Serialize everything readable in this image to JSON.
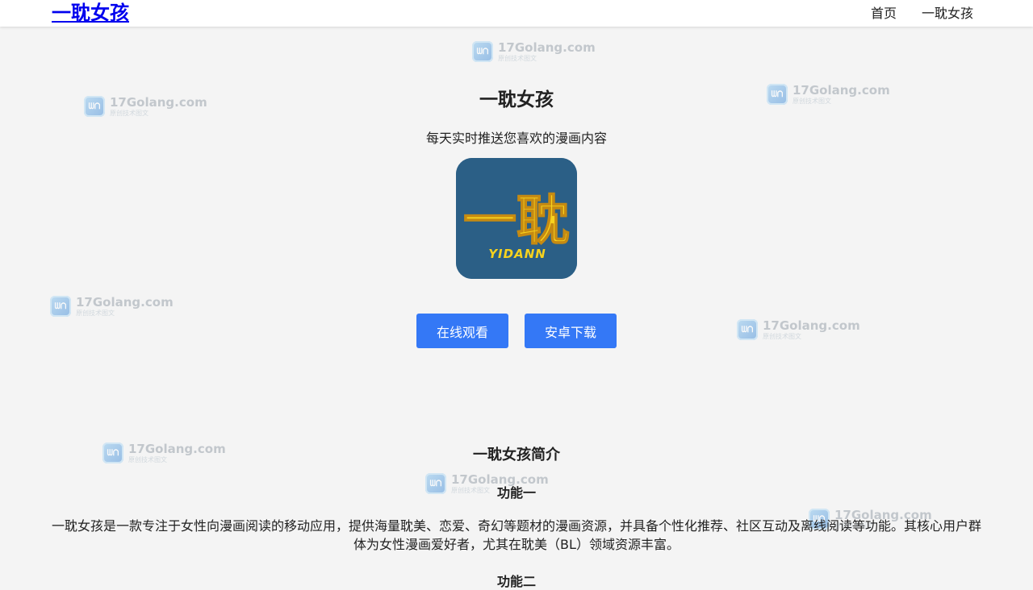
{
  "header": {
    "brand": "一耽女孩",
    "nav": [
      {
        "label": "首页"
      },
      {
        "label": "一耽女孩"
      }
    ]
  },
  "hero": {
    "title": "一耽女孩",
    "subtitle": "每天实时推送您喜欢的漫画内容",
    "app_icon": {
      "glyph": "一耽",
      "wordmark": "YIDANN"
    },
    "buttons": {
      "watch_label": "在线观看",
      "download_label": "安卓下载"
    }
  },
  "intro": {
    "title": "一耽女孩简介",
    "feature_title": "功能一",
    "feature_desc": "一耽女孩是一款专注于女性向漫画阅读的移动应用，提供海量耽美、恋爱、奇幻等题材的漫画资源，并具备个性化推荐、社区互动及离线阅读等功能。其核心用户群体为女性漫画爱好者，尤其在耽美（BL）领域资源丰富。",
    "next_heading": "功能二"
  },
  "watermark": {
    "logo_text": "ᗯᑎ",
    "site": "17Golang.com",
    "tagline": "原创技术图文"
  },
  "colors": {
    "accent": "#3478f6",
    "brand_link": "#0000ee",
    "icon_bg": "#2b5f86",
    "icon_glyph": "#f7d21e",
    "page_bg": "#f4f4f4"
  }
}
